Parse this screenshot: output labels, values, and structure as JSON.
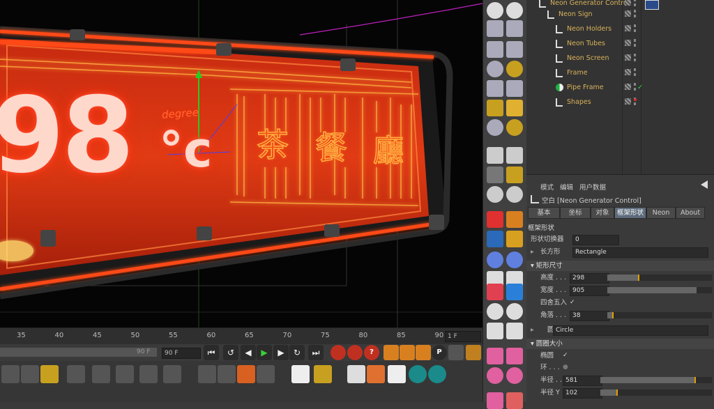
{
  "viewport": {
    "sign_big_number": "98",
    "sign_unit": "°c",
    "sign_degree_word": "degree",
    "sign_chinese": [
      "茶",
      "餐",
      "廳"
    ]
  },
  "timeline": {
    "ticks": [
      "35",
      "40",
      "45",
      "50",
      "55",
      "60",
      "65",
      "70",
      "75",
      "80",
      "85",
      "90"
    ],
    "current_frame": "1 F",
    "end_frame_a": "90 F",
    "end_frame_b": "90 F"
  },
  "object_manager": {
    "items": [
      {
        "label": "Neon Generator Control",
        "depth": 0
      },
      {
        "label": "Neon Sign",
        "depth": 1
      },
      {
        "label": "Neon Holders",
        "depth": 2
      },
      {
        "label": "Neon Tubes",
        "depth": 2
      },
      {
        "label": "Neon Screen",
        "depth": 2
      },
      {
        "label": "Frame",
        "depth": 2
      },
      {
        "label": "Pipe Frame",
        "depth": 2
      },
      {
        "label": "Shapes",
        "depth": 2
      }
    ]
  },
  "attributes": {
    "menu": [
      "模式",
      "编辑",
      "用户数据"
    ],
    "object_title": "空白 [Neon Generator Control]",
    "tabs": [
      "基本",
      "坐标",
      "对象",
      "框架形状",
      "Neon",
      "About"
    ],
    "active_tab": "框架形状",
    "section_frame_shape": "框架形状",
    "shape_switch_label": "形状切换器",
    "shape_switch_value": "0",
    "rect_label": "长方形",
    "rect_value": "Rectangle",
    "section_rect_size": "矩形尺寸",
    "height_label": "高度 . . .",
    "height_value": "298",
    "width_label": "宽度 . . .",
    "width_value": "905",
    "round_label": "四舍五入",
    "corner_label": "角落 . . .",
    "corner_value": "38",
    "circle_label": "圆",
    "circle_value": "Circle",
    "section_circle_size": "圆圈大小",
    "ellipse_label": "椭圆",
    "ring_label": "环 . . .",
    "radius_label": "半径 . . .",
    "radius_value": "581",
    "radius_y_label": "半径 Y",
    "radius_y_value": "102",
    "sliders": {
      "height": 0.3,
      "width": 0.85,
      "corner": 0.05,
      "radius": 0.85,
      "radius_y": 0.15
    }
  },
  "colors": {
    "neon_red": "#ff3a10",
    "neon_orange": "#ff7a20",
    "label_gold": "#d9b25a",
    "active_tab": "#5d6b7c"
  }
}
